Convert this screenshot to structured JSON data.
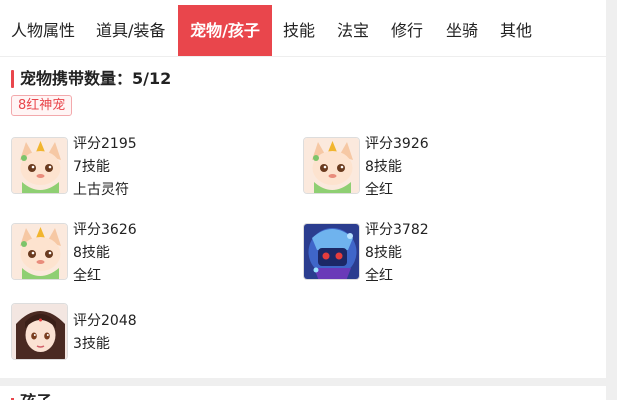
{
  "tabs": [
    {
      "label": "人物属性"
    },
    {
      "label": "道具/装备"
    },
    {
      "label": "宠物/孩子"
    },
    {
      "label": "技能"
    },
    {
      "label": "法宝"
    },
    {
      "label": "修行"
    },
    {
      "label": "坐骑"
    },
    {
      "label": "其他"
    }
  ],
  "active_tab": "宠物/孩子",
  "accent_color": "#e9464c",
  "section": {
    "title": "宠物携带数量：5/12",
    "tag": "8红神宠"
  },
  "pets": [
    {
      "avatar": "fox-spirit-avatar",
      "score": "评分2195",
      "skills": "7技能",
      "note": "上古灵符"
    },
    {
      "avatar": "fox-spirit-avatar",
      "score": "评分3926",
      "skills": "8技能",
      "note": "全红"
    },
    {
      "avatar": "fox-spirit-avatar",
      "score": "评分3626",
      "skills": "8技能",
      "note": "全红"
    },
    {
      "avatar": "armored-beast-avatar",
      "score": "评分3782",
      "skills": "8技能",
      "note": "全红"
    },
    {
      "avatar": "child-girl-avatar",
      "score": "评分2048",
      "skills": "3技能",
      "note": ""
    }
  ],
  "next_section": {
    "title": "孩子"
  }
}
